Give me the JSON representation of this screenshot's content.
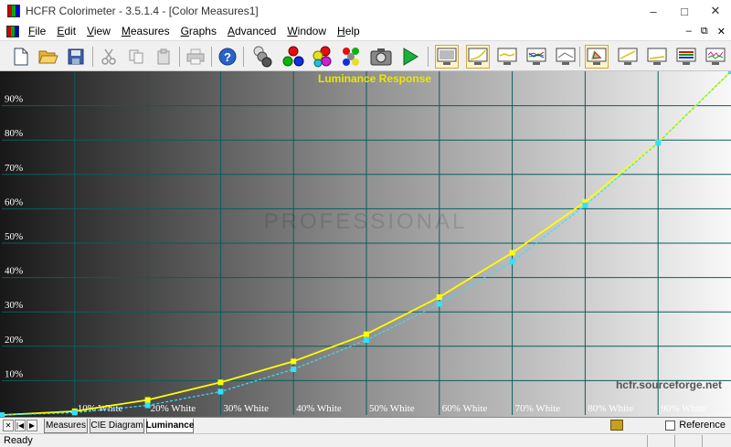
{
  "window": {
    "title": "HCFR Colorimeter - 3.5.1.4 - [Color Measures1]"
  },
  "menu": [
    "File",
    "Edit",
    "View",
    "Measures",
    "Graphs",
    "Advanced",
    "Window",
    "Help"
  ],
  "chart_data": {
    "type": "line",
    "title": "Luminance Response",
    "watermark": "PROFESSIONAL",
    "credit": "hcfr.sourceforge.net",
    "xlabel": "",
    "ylabel": "",
    "x": [
      0,
      10,
      20,
      30,
      40,
      50,
      60,
      70,
      80,
      90,
      100
    ],
    "x_tick_labels": [
      "10% White",
      "20% White",
      "30% White",
      "40% White",
      "50% White",
      "60% White",
      "70% White",
      "80% White",
      "90% White"
    ],
    "y_tick_labels": [
      "10%",
      "20%",
      "30%",
      "40%",
      "50%",
      "60%",
      "70%",
      "80%",
      "90%"
    ],
    "xlim": [
      0,
      100
    ],
    "ylim": [
      0,
      100
    ],
    "grid": true,
    "series": [
      {
        "style": "measured",
        "color": "#ffff00",
        "values": [
          0,
          1.1,
          4.4,
          9.5,
          15.6,
          23.5,
          34.3,
          47.2,
          62.0,
          79.3,
          100
        ]
      },
      {
        "style": "reference",
        "color": "#33e0ff",
        "values": [
          0,
          0.7,
          2.8,
          6.8,
          13.3,
          21.8,
          32.3,
          44.6,
          61.0,
          79.2,
          100
        ]
      }
    ]
  },
  "tabs": [
    "Measures",
    "CIE Diagram",
    "Luminance"
  ],
  "active_tab": "Luminance",
  "reference_label": "Reference",
  "status": {
    "text": "Ready"
  }
}
